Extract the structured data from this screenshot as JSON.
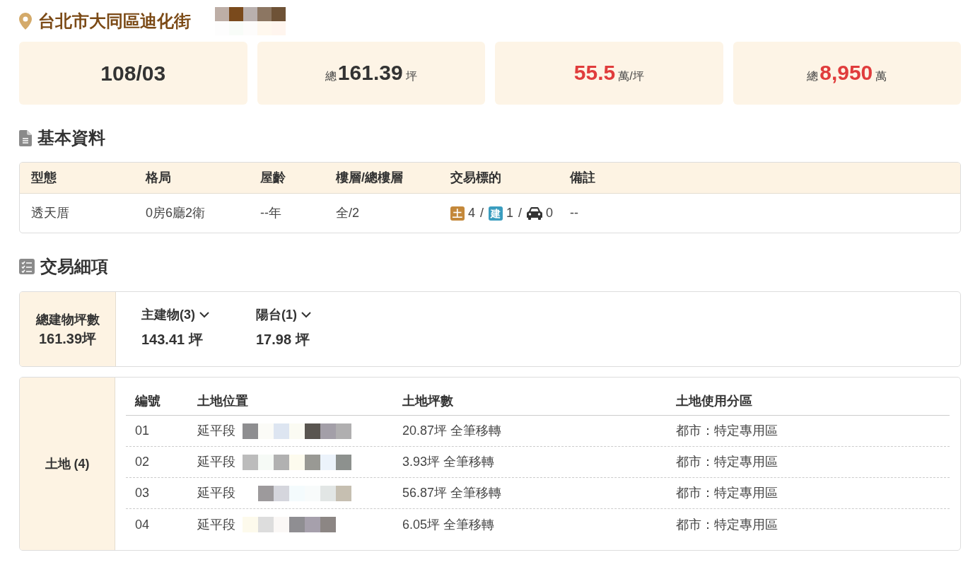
{
  "location": {
    "title": "台北市大同區迪化街"
  },
  "summary_cards": [
    {
      "value": "108/03",
      "color": "#333333"
    },
    {
      "prefix": "總",
      "value": "161.39",
      "unit": "坪",
      "color": "#333333"
    },
    {
      "value": "55.5",
      "unit": "萬/坪",
      "color": "#e03c3c"
    },
    {
      "prefix": "總",
      "value": "8,950",
      "unit": "萬",
      "color": "#e03c3c"
    }
  ],
  "basic_info": {
    "title": "基本資料",
    "columns": [
      "型態",
      "格局",
      "屋齡",
      "樓層/總樓層",
      "交易標的",
      "備註"
    ],
    "rows": [
      {
        "cells": [
          {
            "kind": "text",
            "text": "透天厝"
          },
          {
            "kind": "text",
            "text": "0房6廳2衛"
          },
          {
            "kind": "text",
            "text": "--年"
          },
          {
            "kind": "text",
            "text": "全/2"
          },
          {
            "kind": "targets",
            "separator": "/",
            "items": [
              {
                "kind": "badge",
                "badge": "土",
                "color": "#c4883a",
                "count": "4"
              },
              {
                "kind": "badge",
                "badge": "建",
                "color": "#3a9dbf",
                "count": "1"
              },
              {
                "kind": "parking",
                "count": "0"
              }
            ]
          },
          {
            "kind": "text",
            "text": "--"
          }
        ]
      }
    ]
  },
  "transaction_details": {
    "title": "交易細項",
    "building": {
      "label": "總建物坪數",
      "value": "161.39坪",
      "parts": [
        {
          "label": "主建物(3)",
          "value": "143.41 坪",
          "expanded": false
        },
        {
          "label": "陽台(1)",
          "value": "17.98 坪",
          "expanded": false
        }
      ]
    },
    "land": {
      "label": "土地 (4)",
      "columns": [
        "編號",
        "土地位置",
        "土地坪數",
        "土地使用分區"
      ],
      "rows": [
        {
          "number": "01",
          "location": "延平段",
          "area": "20.87坪 全筆移轉",
          "zoning": "都市：特定專用區"
        },
        {
          "number": "02",
          "location": "延平段",
          "area": "3.93坪 全筆移轉",
          "zoning": "都市：特定專用區"
        },
        {
          "number": "03",
          "location": "延平段",
          "area": "56.87坪 全筆移轉",
          "zoning": "都市：特定專用區"
        },
        {
          "number": "04",
          "location": "延平段",
          "area": "6.05坪 全筆移轉",
          "zoning": "都市：特定專用區"
        }
      ]
    }
  }
}
